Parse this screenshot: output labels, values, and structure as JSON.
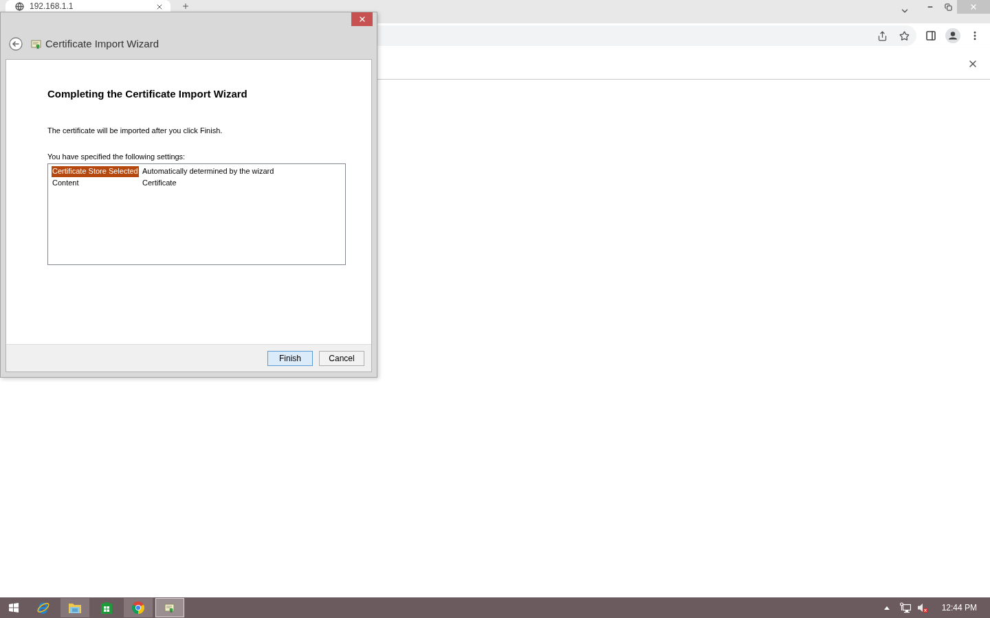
{
  "browser": {
    "tabs": [
      {
        "title": "192.168.1.1",
        "selected": true
      }
    ]
  },
  "dialog": {
    "title": "Certificate Import Wizard",
    "heading": "Completing the Certificate Import Wizard",
    "message": "The certificate will be imported after you click Finish.",
    "settings_label": "You have specified the following settings:",
    "settings": [
      {
        "name": "Certificate Store Selected",
        "value": "Automatically determined by the wizard",
        "selected": true
      },
      {
        "name": "Content",
        "value": "Certificate",
        "selected": false
      }
    ],
    "buttons": [
      {
        "label": "Finish",
        "default": true
      },
      {
        "label": "Cancel",
        "default": false
      }
    ]
  },
  "taskbar": {
    "apps": [
      {
        "kind": "ie",
        "running": false,
        "focused": false
      },
      {
        "kind": "explorer",
        "running": true,
        "focused": false
      },
      {
        "kind": "store",
        "running": false,
        "focused": false
      },
      {
        "kind": "chrome",
        "running": true,
        "focused": false
      },
      {
        "kind": "certificate",
        "running": true,
        "focused": true
      }
    ],
    "tray": {
      "volume_muted": true,
      "clock": "12:44 PM"
    }
  }
}
